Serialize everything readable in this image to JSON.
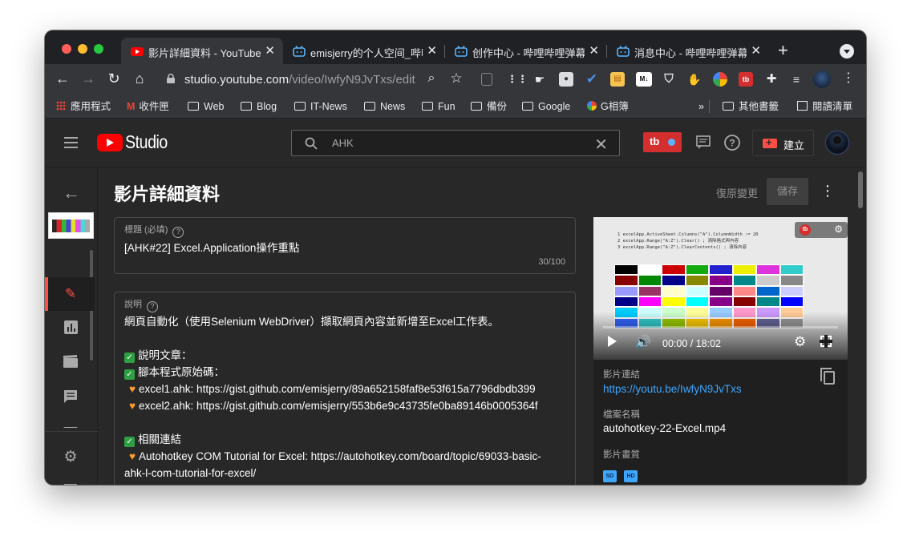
{
  "browser": {
    "tabs": [
      {
        "title": "影片詳細資料 - YouTube Studio",
        "icon": "youtube-icon",
        "active": true
      },
      {
        "title": "emisjerry的个人空间_哔哩哔哩",
        "icon": "bilibili-icon",
        "active": false
      },
      {
        "title": "创作中心 - 哔哩哔哩弹幕视频网",
        "icon": "bilibili-icon",
        "active": false
      },
      {
        "title": "消息中心 - 哔哩哔哩弹幕视频网",
        "icon": "bilibili-icon",
        "active": false
      }
    ],
    "tab_close": "✕",
    "new_tab": "+",
    "url_host": "studio.youtube.com",
    "url_path": "/video/IwfyN9JvTxs/edit",
    "bookmarks": [
      {
        "label": "應用程式",
        "icon": "apps-grid-icon"
      },
      {
        "label": "收件匣",
        "icon": "gmail-icon"
      },
      {
        "label": "Web",
        "icon": "folder-icon"
      },
      {
        "label": "Blog",
        "icon": "folder-icon"
      },
      {
        "label": "IT-News",
        "icon": "folder-icon"
      },
      {
        "label": "News",
        "icon": "folder-icon"
      },
      {
        "label": "Fun",
        "icon": "folder-icon"
      },
      {
        "label": "備份",
        "icon": "folder-icon"
      },
      {
        "label": "Google",
        "icon": "folder-icon"
      },
      {
        "label": "G相簿",
        "icon": "google-photos-icon"
      }
    ],
    "bookmarks_more": "»",
    "other_bookmarks": "其他書籤",
    "reading_list": "閱讀清單"
  },
  "studio": {
    "logo_text": "Studio",
    "search_value": "AHK",
    "search_clear": "✕",
    "ext_badge": "tb",
    "create_label": "建立",
    "colors": {
      "accent": "#ff4e45",
      "link": "#3ea6ff",
      "bg": "#282828"
    }
  },
  "page": {
    "title": "影片詳細資料",
    "undo_label": "復原變更",
    "save_label": "儲存",
    "more": "⋮"
  },
  "title_field": {
    "label": "標題 (必填)",
    "value": "[AHK#22] Excel.Application操作重點",
    "count": "30/100"
  },
  "description_field": {
    "label": "說明",
    "lines": [
      {
        "type": "text",
        "text": "網頁自動化（使用Selenium WebDriver）擷取網頁內容並新增至Excel工作表。"
      },
      {
        "type": "blank",
        "text": ""
      },
      {
        "type": "check",
        "text": "說明文章："
      },
      {
        "type": "check",
        "text": "腳本程式原始碼："
      },
      {
        "type": "heart",
        "text": "excel1.ahk: https://gist.github.com/emisjerry/89a652158faf8e53f615a7796dbdb399"
      },
      {
        "type": "heart",
        "text": "excel2.ahk: https://gist.github.com/emisjerry/553b6e9c43735fe0ba89146b0005364f"
      },
      {
        "type": "blank",
        "text": ""
      },
      {
        "type": "check",
        "text": "相關連結"
      },
      {
        "type": "heart",
        "text": "Autohotkey COM Tutorial for Excel: https://autohotkey.com/board/topic/69033-basic-"
      },
      {
        "type": "text",
        "text": "ahk-l-com-tutorial-for-excel/"
      }
    ]
  },
  "video": {
    "time": "00:00 / 18:02",
    "progress": 0,
    "link_label": "影片連結",
    "link_value": "https://youtu.be/IwfyN9JvTxs",
    "file_label": "檔案名稱",
    "file_value": "autohotkey-22-Excel.mp4",
    "quality_label": "影片畫質",
    "quality_badges": [
      "SD",
      "HD"
    ],
    "sheet_code": [
      "1  excelApp.ActiveSheet.Columns(\"A\").ColumnWidth := 20",
      "2  excelApp.Range(\"A:Z\").Clear()  ; 清除格式與內容",
      "3  excelApp.Range(\"A:Z\").ClearContents()  ; 清除內容"
    ]
  }
}
